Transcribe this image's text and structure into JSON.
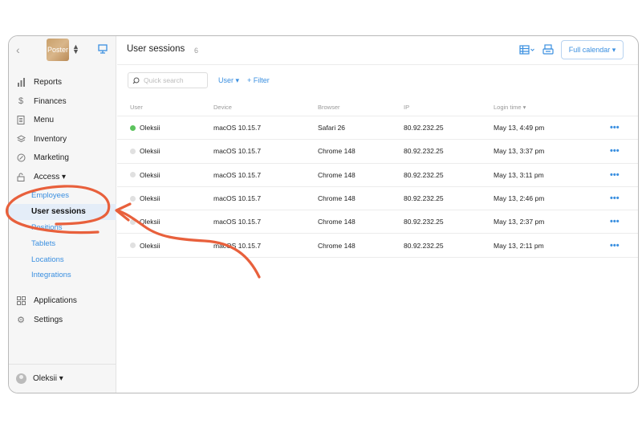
{
  "sidebar": {
    "logo_text": "Poster",
    "nav": [
      {
        "label": "Reports",
        "icon": "bar-chart-icon"
      },
      {
        "label": "Finances",
        "icon": "dollar-icon"
      },
      {
        "label": "Menu",
        "icon": "document-icon"
      },
      {
        "label": "Inventory",
        "icon": "layers-icon"
      },
      {
        "label": "Marketing",
        "icon": "percent-icon"
      },
      {
        "label": "Access ▾",
        "icon": "lock-icon"
      }
    ],
    "access_sub": [
      {
        "label": "Employees"
      },
      {
        "label": "User sessions",
        "active": true
      },
      {
        "label": "Positions"
      },
      {
        "label": "Tablets"
      },
      {
        "label": "Locations"
      },
      {
        "label": "Integrations"
      }
    ],
    "nav_bottom": [
      {
        "label": "Applications",
        "icon": "grid-icon"
      },
      {
        "label": "Settings",
        "icon": "gear-icon"
      }
    ],
    "user": "Oleksii ▾"
  },
  "header": {
    "title": "User sessions",
    "count": "6",
    "calendar_button": "Full calendar ▾"
  },
  "filters": {
    "search_placeholder": "Quick search",
    "user_filter": "User ▾",
    "add_filter": "+ Filter"
  },
  "table": {
    "columns": [
      "User",
      "Device",
      "Browser",
      "IP",
      "Login time ▾"
    ],
    "rows": [
      {
        "user": "Oleksii",
        "online": true,
        "device": "macOS 10.15.7",
        "browser": "Safari 26",
        "ip": "80.92.232.25",
        "time": "May 13, 4:49 pm"
      },
      {
        "user": "Oleksii",
        "online": false,
        "device": "macOS 10.15.7",
        "browser": "Chrome 148",
        "ip": "80.92.232.25",
        "time": "May 13, 3:37 pm"
      },
      {
        "user": "Oleksii",
        "online": false,
        "device": "macOS 10.15.7",
        "browser": "Chrome 148",
        "ip": "80.92.232.25",
        "time": "May 13, 3:11 pm"
      },
      {
        "user": "Oleksii",
        "online": false,
        "device": "macOS 10.15.7",
        "browser": "Chrome 148",
        "ip": "80.92.232.25",
        "time": "May 13, 2:46 pm"
      },
      {
        "user": "Oleksii",
        "online": false,
        "device": "macOS 10.15.7",
        "browser": "Chrome 148",
        "ip": "80.92.232.25",
        "time": "May 13, 2:37 pm"
      },
      {
        "user": "Oleksii",
        "online": false,
        "device": "macOS 10.15.7",
        "browser": "Chrome 148",
        "ip": "80.92.232.25",
        "time": "May 13, 2:11 pm"
      }
    ],
    "more_label": "•••"
  },
  "colors": {
    "accent": "#3a8fe0",
    "online": "#5cc35d",
    "annotation": "#e8603c",
    "active_bg": "#e4edf8"
  }
}
